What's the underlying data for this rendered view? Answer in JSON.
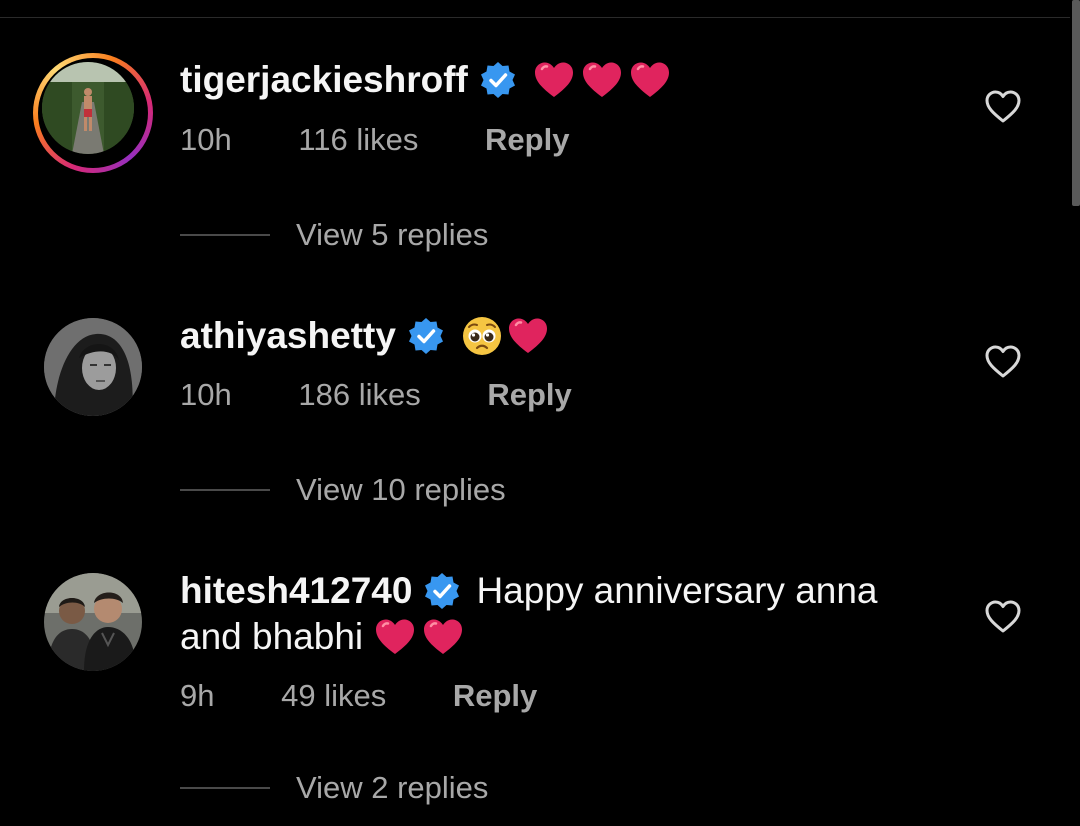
{
  "comments": [
    {
      "username": "tigerjackieshroff",
      "verified": true,
      "text": "",
      "emojis": [
        "heart-emoji",
        "heart-emoji",
        "heart-emoji"
      ],
      "time": "10h",
      "likes": "116 likes",
      "reply_label": "Reply",
      "view_replies": "View 5 replies",
      "has_story_ring": true
    },
    {
      "username": "athiyashetty",
      "verified": true,
      "text": "",
      "emojis": [
        "pleading-face-emoji",
        "heart-emoji"
      ],
      "time": "10h",
      "likes": "186 likes",
      "reply_label": "Reply",
      "view_replies": "View 10 replies",
      "has_story_ring": false
    },
    {
      "username": "hitesh412740",
      "verified": true,
      "text": "Happy anniversary anna",
      "text_line2": "and bhabhi",
      "emojis": [
        "heart-emoji",
        "heart-emoji"
      ],
      "time": "9h",
      "likes": "49 likes",
      "reply_label": "Reply",
      "view_replies": "View 2 replies",
      "has_story_ring": false
    }
  ],
  "colors": {
    "background": "#000000",
    "primary_text": "#f5f5f5",
    "secondary_text": "#a8a8a8",
    "verified_blue": "#3897f0",
    "heart_red": "#e0245e"
  }
}
